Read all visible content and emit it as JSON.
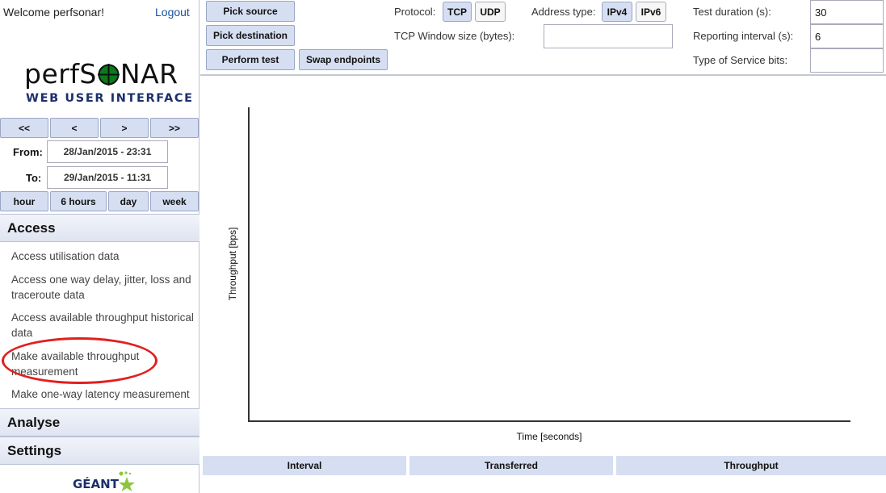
{
  "header": {
    "welcome": "Welcome perfsonar!",
    "logout": "Logout"
  },
  "logo": {
    "main": "perfSONAR",
    "sub": "WEB USER INTERFACE"
  },
  "nav": {
    "first": "<<",
    "prev": "<",
    "next": ">",
    "last": ">>"
  },
  "dates": {
    "from_label": "From:",
    "from_value": "28/Jan/2015 - 23:31",
    "to_label": "To:",
    "to_value": "29/Jan/2015 - 11:31"
  },
  "ranges": [
    "hour",
    "6 hours",
    "day",
    "week"
  ],
  "sections": {
    "access": "Access",
    "access_items": [
      "Access utilisation data",
      "Access one way delay, jitter, loss and traceroute data",
      "Access available throughput historical data",
      "Make available throughput measurement",
      "Make one-way latency measurement"
    ],
    "analyse": "Analyse",
    "settings": "Settings"
  },
  "footer_logo": "GÉANT",
  "toolbar": {
    "pick_source": "Pick source",
    "pick_destination": "Pick destination",
    "perform_test": "Perform test",
    "swap_endpoints": "Swap endpoints"
  },
  "options": {
    "protocol_label": "Protocol:",
    "protocol_tcp": "TCP",
    "protocol_udp": "UDP",
    "protocol_selected": "TCP",
    "address_label": "Address type:",
    "address_ipv4": "IPv4",
    "address_ipv6": "IPv6",
    "address_selected": "IPv4",
    "tcp_window_label": "TCP Window size (bytes):",
    "tcp_window_value": "",
    "duration_label": "Test duration (s):",
    "duration_value": "30",
    "interval_label": "Reporting interval (s):",
    "interval_value": "6",
    "tos_label": "Type of Service bits:",
    "tos_value": ""
  },
  "chart_data": {
    "type": "line",
    "title": "",
    "xlabel": "Time [seconds]",
    "ylabel": "Throughput [bps]",
    "series": []
  },
  "results_table": {
    "columns": [
      "Interval",
      "Transferred",
      "Throughput"
    ]
  },
  "colors": {
    "button_bg": "#d6def2",
    "highlight": "#e02020",
    "link": "#1a4fa0"
  }
}
